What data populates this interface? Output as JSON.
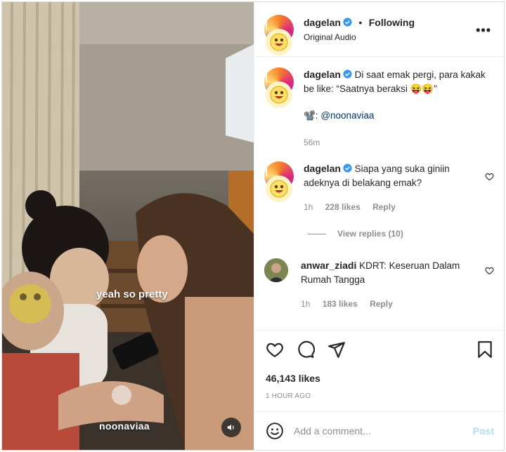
{
  "post": {
    "author": "dagelan",
    "follow_state": "Following",
    "separator": "•",
    "audio": "Original Audio",
    "more": "•••"
  },
  "video": {
    "caption": "yeah so pretty",
    "watermark": "noonaviaa"
  },
  "caption": {
    "author": "dagelan",
    "text": "Di saat emak pergi, para kakak be like: “Saatnya beraksi 😝😝”",
    "credit_icon": "📽️:",
    "credit_handle": "@noonaviaa",
    "time": "56m"
  },
  "comments": [
    {
      "author": "dagelan",
      "text": "Siapa yang suka giniin adeknya di belakang emak?",
      "time": "1h",
      "likes": "228 likes",
      "reply": "Reply",
      "view_replies": "View replies (10)"
    },
    {
      "author": "anwar_ziadi",
      "text": "KDRT: Keseruan Dalam Rumah Tangga",
      "time": "1h",
      "likes": "183 likes",
      "reply": "Reply"
    }
  ],
  "engagement": {
    "likes": "46,143 likes",
    "posted": "1 HOUR AGO"
  },
  "composer": {
    "placeholder": "Add a comment...",
    "post_label": "Post"
  },
  "icons": {
    "verified": "verified-badge-icon",
    "heart": "heart-icon",
    "comment": "comment-icon",
    "share": "share-icon",
    "bookmark": "bookmark-icon",
    "emoji": "emoji-icon",
    "sound": "speaker-icon"
  },
  "colors": {
    "verified": "#3897f0",
    "link": "#00376b",
    "muted": "#8e8e8e",
    "post_disabled": "#b3dbff"
  }
}
